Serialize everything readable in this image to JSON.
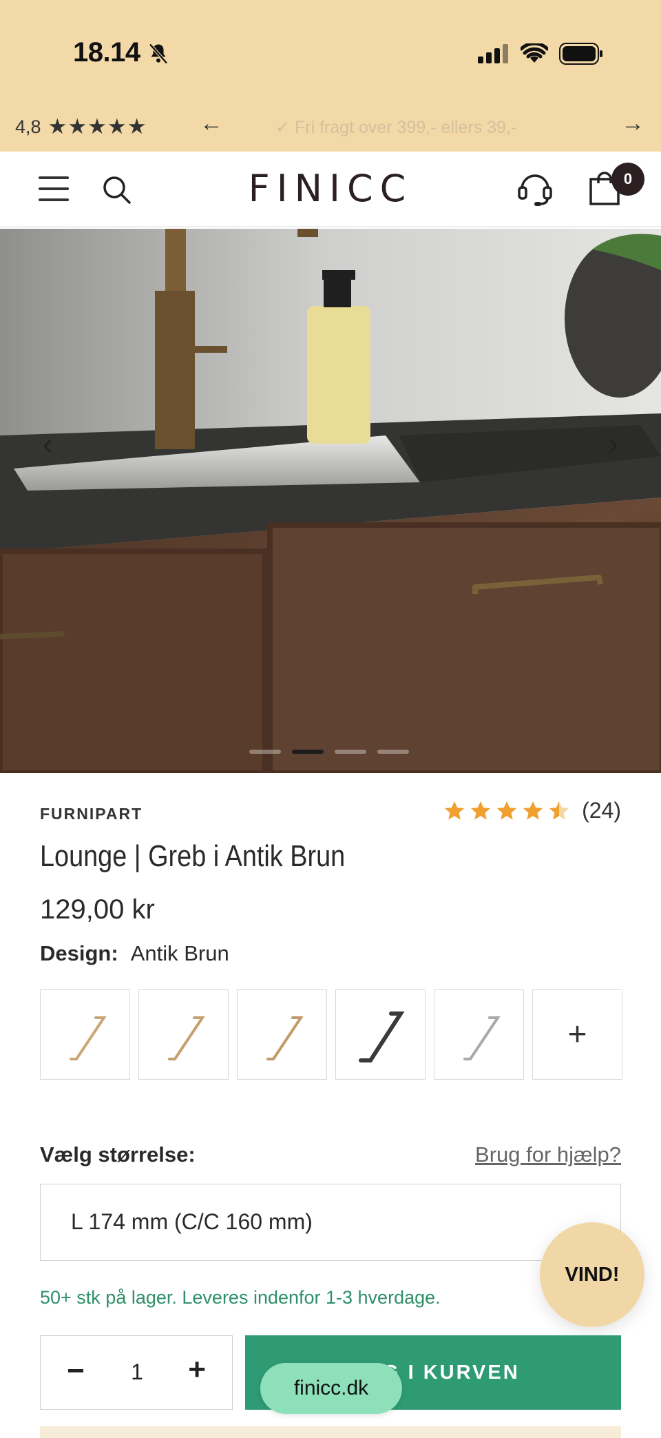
{
  "status_bar": {
    "time": "18.14",
    "icons": [
      "bell-muted-icon",
      "signal-icon",
      "wifi-icon",
      "battery-icon"
    ]
  },
  "announcement": {
    "rating": "4,8",
    "stars": "★★★★★",
    "message": "✓ Fri fragt over 399,- ellers 39,-",
    "prev_icon": "←",
    "next_icon": "→"
  },
  "header": {
    "logo": "FINICC",
    "cart_count": "0",
    "icons": [
      "menu-icon",
      "search-icon",
      "support-headset-icon",
      "cart-icon"
    ]
  },
  "gallery": {
    "prev": "‹",
    "next": "›",
    "slide_count": 4,
    "active_slide": 2
  },
  "product": {
    "brand": "FURNIPART",
    "rating_value": 4.5,
    "review_count": "(24)",
    "title": "Lounge | Greb i Antik Brun",
    "price": "129,00 kr",
    "design_label": "Design:",
    "design_value": "Antik Brun",
    "swatch_colors": [
      "#c9a679",
      "#c4a070",
      "#c19a6a",
      "#3a3a3a",
      "#a9a9a9"
    ],
    "more_swatches": "+"
  },
  "size": {
    "label": "Vælg størrelse:",
    "help": "Brug for hjælp?",
    "selected": "L 174 mm (C/C 160 mm)"
  },
  "stock_text": "50+ stk på lager. Leveres indenfor 1-3 hverdage.",
  "quantity": {
    "minus": "−",
    "value": "1",
    "plus": "+"
  },
  "add_to_cart": "LÆG I KURVEN",
  "floating": {
    "vind": "VIND!",
    "url": "finicc.dk"
  },
  "colors": {
    "accent_green": "#2e9b74",
    "header_beige": "#f3d9a7",
    "star_orange": "#f0a030"
  }
}
